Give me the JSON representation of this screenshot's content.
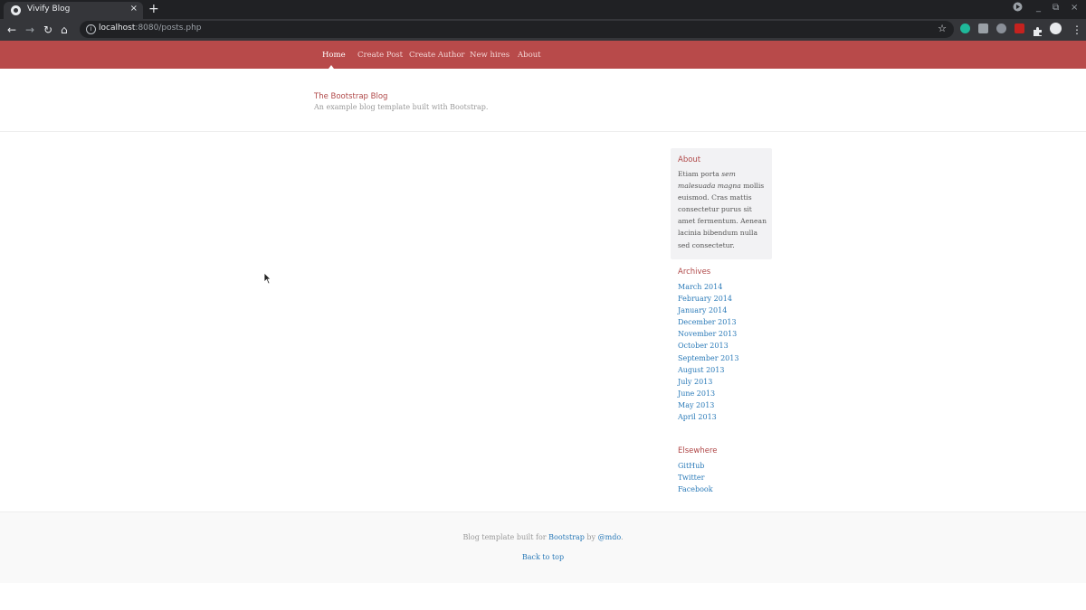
{
  "browser": {
    "tab_title": "Vivify Blog",
    "tab_close": "×",
    "new_tab": "+",
    "url_host": "localhost",
    "url_rest": ":8080/posts.php",
    "win_min": "_",
    "win_restore": "⧉",
    "win_close": "×",
    "icons": {
      "back": "←",
      "forward": "→",
      "reload": "↻",
      "home": "⌂",
      "star": "☆",
      "menu": "⋮"
    }
  },
  "nav": {
    "items": [
      {
        "label": "Home",
        "active": true
      },
      {
        "label": "Create Post"
      },
      {
        "label": "Create Author"
      },
      {
        "label": "New hires"
      },
      {
        "label": "About"
      }
    ]
  },
  "header": {
    "title": "The Bootstrap Blog",
    "description": "An example blog template built with Bootstrap."
  },
  "sidebar": {
    "about_heading": "About",
    "about_text_1": "Etiam porta ",
    "about_text_em": "sem malesuada magna",
    "about_text_2": " mollis euismod. Cras mattis consectetur purus sit amet fermentum. Aenean lacinia bibendum nulla sed consectetur.",
    "archives_heading": "Archives",
    "archives": [
      "March 2014",
      "February 2014",
      "January 2014",
      "December 2013",
      "November 2013",
      "October 2013",
      "September 2013",
      "August 2013",
      "July 2013",
      "June 2013",
      "May 2013",
      "April 2013"
    ],
    "elsewhere_heading": "Elsewhere",
    "elsewhere": [
      "GitHub",
      "Twitter",
      "Facebook"
    ]
  },
  "footer": {
    "text_1": "Blog template built for ",
    "link_1": "Bootstrap",
    "text_2": " by ",
    "link_2": "@mdo",
    "text_3": ".",
    "back_to_top": "Back to top"
  },
  "colors": {
    "navbar": "#b84a4a",
    "link": "#2a7ab8",
    "heading": "#b04848"
  }
}
